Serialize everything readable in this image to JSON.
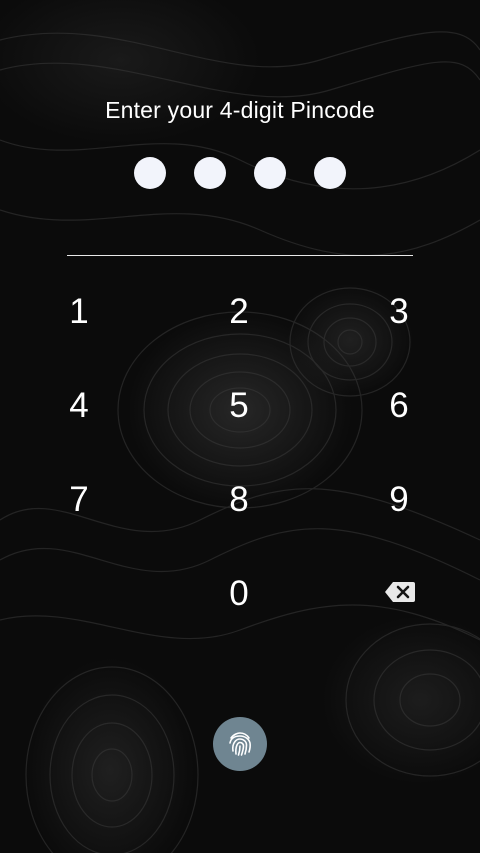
{
  "prompt": "Enter your 4-digit Pincode",
  "pin": {
    "length": 4,
    "entered": 4
  },
  "keypad": {
    "keys": [
      "1",
      "2",
      "3",
      "4",
      "5",
      "6",
      "7",
      "8",
      "9",
      "0"
    ]
  },
  "icons": {
    "backspace": "backspace-icon",
    "fingerprint": "fingerprint-icon"
  },
  "colors": {
    "text": "#ffffff",
    "dot_filled": "#f2f4fb",
    "fingerprint_button": "#6f8591",
    "background": "#0b0b0b"
  }
}
